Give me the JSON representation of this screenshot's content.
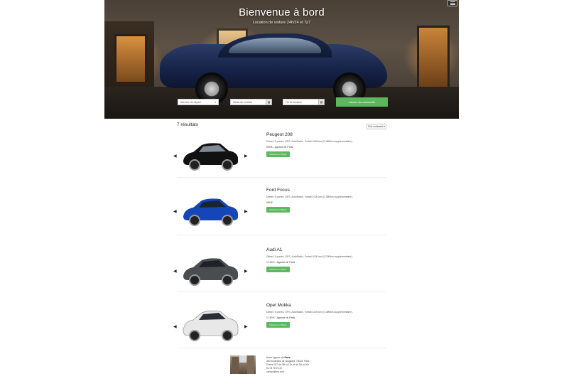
{
  "hero": {
    "title": "Bienvenue à bord",
    "subtitle": "Location de voiture 24h/24 et 7j/7"
  },
  "search": {
    "address_placeholder": "Adresse de départ",
    "start_placeholder": "Début de location",
    "end_placeholder": "Fin de location",
    "button_label": "Lancer ma recherche"
  },
  "results": {
    "count_label": "7 résultats",
    "sort_label": "Prix croissant ▾",
    "cars": [
      {
        "name": "Peugeot 208",
        "description": "Diesel, 5 portes, GPS, AutoRadio, Forfait 1000 km (0,18€/km supplémentaire).",
        "price": "999 € - Agence de Paris",
        "button": "Réserver et Payer",
        "color": "#111111"
      },
      {
        "name": "Ford Focus",
        "description": "Diesel, 5 portes, GPS, AutoRadio, Forfait 1000 km (0,18€/km supplémentaire).",
        "price": "999 €",
        "button": "Réserver et Payer",
        "color": "#1546b8"
      },
      {
        "name": "Audi A1",
        "description": "Diesel, 5 portes, GPS, AutoRadio, Forfait 1000 km (0,22€/km supplémentaire).",
        "price": "1 100 € - Agence de Paris",
        "button": "Réserver et Payer",
        "color": "#4a4d50"
      },
      {
        "name": "Opel Mokka",
        "description": "Diesel, 5 portes, GPS, AutoRadio, Forfait 1000 km (0,18€/km supplémentaire).",
        "price": "1 150 € - Agence de Paris",
        "button": "Réserver et Payer",
        "color": "#e8e8e8"
      }
    ]
  },
  "footer": {
    "agency_prefix": "Notre Agence de",
    "agency_city": "Paris",
    "address": "300 boulevard de vaugirard, 75015, Paris",
    "hours": "Ouvert 7j/7 de 09h à 13h et de 14h à 20h",
    "phone": "01 09 78 21 22",
    "email": "contact@rnt.com"
  },
  "colors": {
    "accent": "#5cb85c"
  },
  "icons": {
    "menu": "hamburger-icon",
    "calendar": "calendar-icon",
    "prev": "triangle-left-icon",
    "next": "triangle-right-icon"
  }
}
